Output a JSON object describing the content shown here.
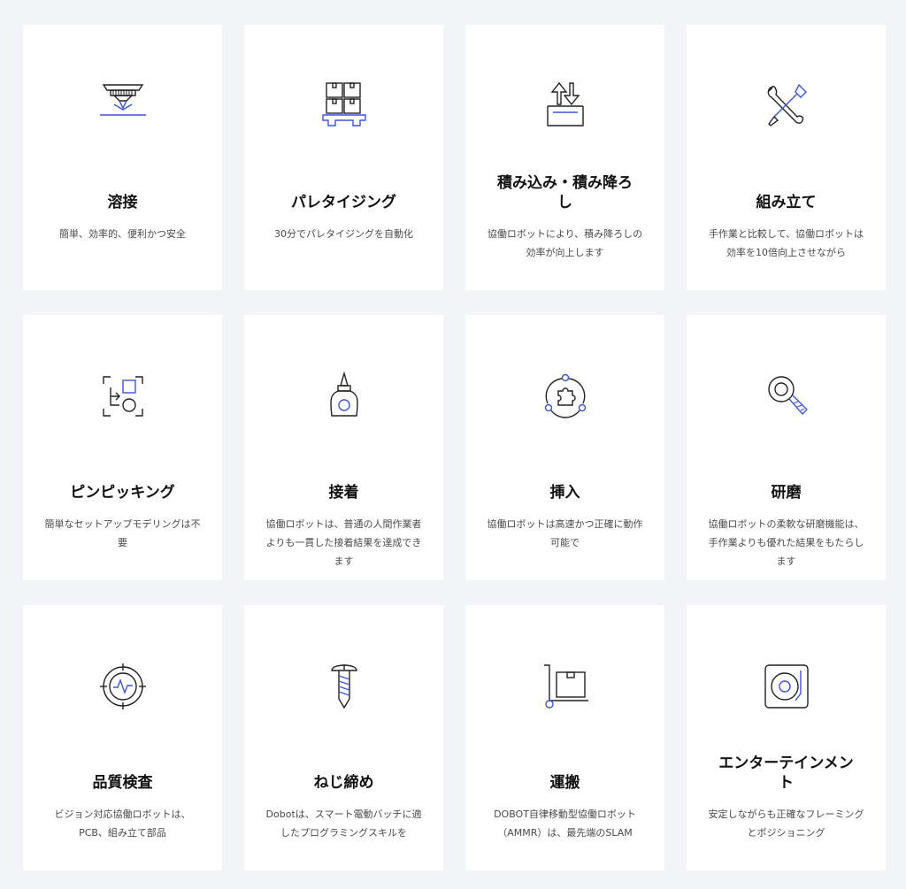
{
  "cards": [
    {
      "title": "溶接",
      "desc": "簡単、効率的、便利かつ安全",
      "icon": "welding-icon"
    },
    {
      "title": "パレタイジング",
      "desc": "30分でパレタイジングを自動化",
      "icon": "palletizing-icon"
    },
    {
      "title": "積み込み・積み降ろし",
      "desc": "協働ロボットにより、積み降ろしの効率が向上します",
      "icon": "loading-unloading-icon"
    },
    {
      "title": "組み立て",
      "desc": "手作業と比較して、協働ロボットは効率を10倍向上させながら",
      "icon": "assembly-tools-icon"
    },
    {
      "title": "ピンピッキング",
      "desc": "簡単なセットアップモデリングは不要",
      "icon": "bin-picking-icon"
    },
    {
      "title": "接着",
      "desc": "協働ロボットは、普通の人間作業者よりも一貫した接着結果を達成できます",
      "icon": "glue-bottle-icon"
    },
    {
      "title": "挿入",
      "desc": "協働ロボットは高速かつ正確に動作可能で",
      "icon": "puzzle-insert-icon"
    },
    {
      "title": "研磨",
      "desc": "協働ロボットの柔軟な研磨機能は、手作業よりも優れた結果をもたらします",
      "icon": "polishing-icon"
    },
    {
      "title": "品質検査",
      "desc": "ビジョン対応協働ロボットは、PCB、組み立て部品",
      "icon": "inspection-target-icon"
    },
    {
      "title": "ねじ締め",
      "desc": "Dobotは、スマート電動バッチに適したプログラミングスキルを",
      "icon": "screw-icon"
    },
    {
      "title": "運搬",
      "desc": "DOBOT自律移動型協働ロボット（AMMR）は、最先端のSLAM",
      "icon": "hand-truck-box-icon"
    },
    {
      "title": "エンターテインメント",
      "desc": "安定しながらも正確なフレーミングとポジショニング",
      "icon": "turntable-icon"
    }
  ],
  "colors": {
    "page_bg": "#f3f4f7",
    "card_bg": "#ffffff",
    "icon_stroke": "#222222",
    "icon_accent": "#3b55d9"
  }
}
